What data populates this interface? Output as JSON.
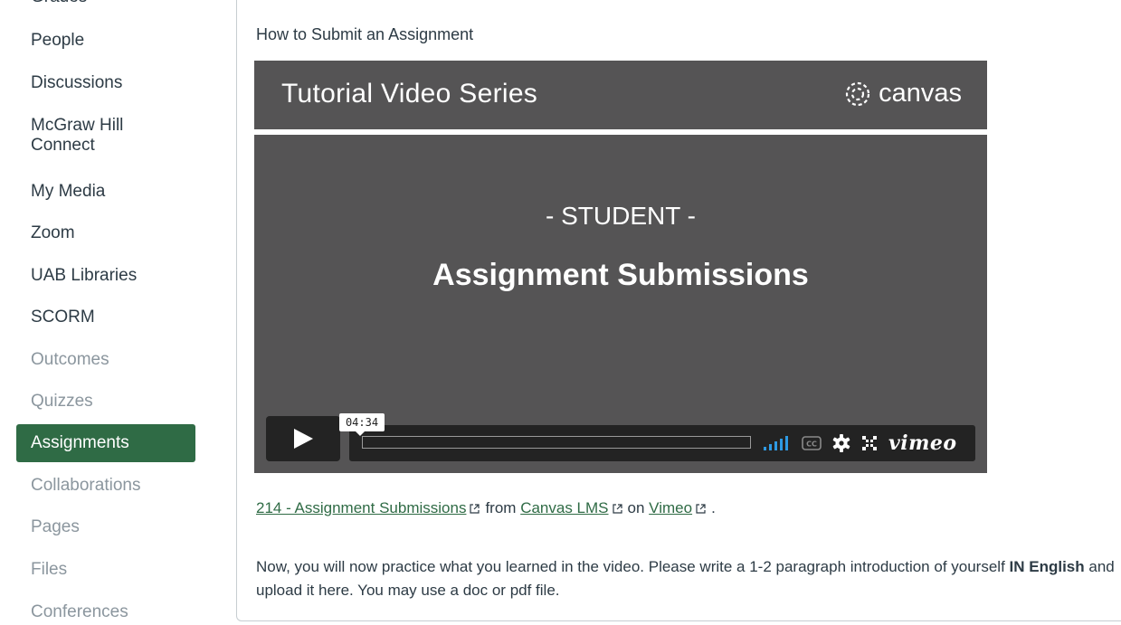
{
  "sidebar": {
    "cut_item": "Grades",
    "items": [
      {
        "label": "People",
        "state": "normal"
      },
      {
        "label": "Discussions",
        "state": "normal"
      },
      {
        "label": "McGraw Hill\nConnect",
        "state": "normal"
      },
      {
        "label": "My Media",
        "state": "normal"
      },
      {
        "label": "Zoom",
        "state": "normal"
      },
      {
        "label": "UAB Libraries",
        "state": "normal"
      },
      {
        "label": "SCORM",
        "state": "normal"
      },
      {
        "label": "Outcomes",
        "state": "muted"
      },
      {
        "label": "Quizzes",
        "state": "muted"
      },
      {
        "label": "Assignments",
        "state": "active"
      },
      {
        "label": "Collaborations",
        "state": "muted"
      },
      {
        "label": "Pages",
        "state": "muted"
      },
      {
        "label": "Files",
        "state": "muted"
      },
      {
        "label": "Conferences",
        "state": "muted"
      }
    ]
  },
  "content": {
    "heading": "How to Submit an Assignment",
    "video": {
      "series_title": "Tutorial Video Series",
      "brand": "canvas",
      "subtitle": "- STUDENT -",
      "title": "Assignment Submissions",
      "duration": "04:34",
      "cc_label": "CC",
      "player_brand": "vimeo"
    },
    "source": {
      "video_link": "214 - Assignment Submissions",
      "from_text": "from",
      "channel_link": "Canvas LMS",
      "on_text": "on",
      "site_link": "Vimeo",
      "end_text": "."
    },
    "instructions": {
      "part1": "Now, you will now practice what you learned in the  video.  Please write a 1-2 paragraph introduction of yourself ",
      "bold": "IN English",
      "part2": " and upload it here. You may use a doc or pdf file."
    }
  },
  "colors": {
    "accent": "#2f6b45",
    "video_bg": "#555455",
    "volume_blue": "#2e9ae3"
  }
}
